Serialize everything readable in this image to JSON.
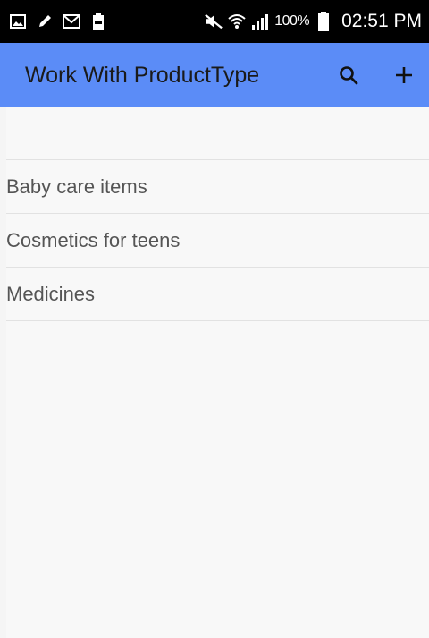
{
  "status_bar": {
    "icons_left": [
      "gallery-icon",
      "pencil-icon",
      "gmail-icon",
      "battery-small-icon"
    ],
    "icons_right": [
      "mute-icon",
      "wifi-icon",
      "signal-icon"
    ],
    "battery_percent": "100%",
    "time": "02:51 PM"
  },
  "app_bar": {
    "title": "Work With ProductType",
    "search_icon": "search-icon",
    "add_icon": "plus-icon",
    "color": "#5b8cf7"
  },
  "list": {
    "items": [
      {
        "label": "Baby care items"
      },
      {
        "label": "Cosmetics for teens"
      },
      {
        "label": "Medicines"
      }
    ]
  }
}
